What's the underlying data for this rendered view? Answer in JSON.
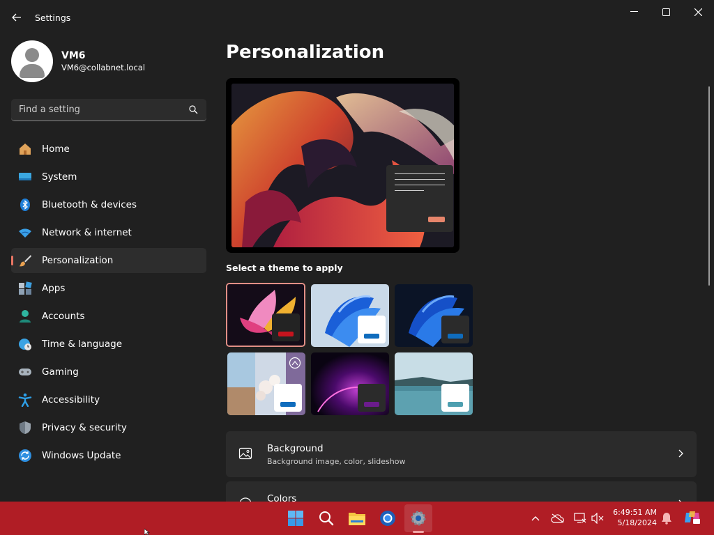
{
  "window": {
    "title": "Settings"
  },
  "profile": {
    "name": "VM6",
    "email": "VM6@collabnet.local"
  },
  "search": {
    "placeholder": "Find a setting"
  },
  "sidebar": {
    "items": [
      {
        "label": "Home",
        "icon": "home-icon"
      },
      {
        "label": "System",
        "icon": "system-icon"
      },
      {
        "label": "Bluetooth & devices",
        "icon": "bluetooth-icon"
      },
      {
        "label": "Network & internet",
        "icon": "wifi-icon"
      },
      {
        "label": "Personalization",
        "icon": "brush-icon",
        "active": true
      },
      {
        "label": "Apps",
        "icon": "apps-icon"
      },
      {
        "label": "Accounts",
        "icon": "accounts-icon"
      },
      {
        "label": "Time & language",
        "icon": "clock-globe-icon"
      },
      {
        "label": "Gaming",
        "icon": "gamepad-icon"
      },
      {
        "label": "Accessibility",
        "icon": "accessibility-icon"
      },
      {
        "label": "Privacy & security",
        "icon": "shield-icon"
      },
      {
        "label": "Windows Update",
        "icon": "update-icon"
      }
    ]
  },
  "main": {
    "title": "Personalization",
    "theme_heading": "Select a theme to apply",
    "themes": [
      {
        "name": "theme-glow",
        "accent": "#c6141e",
        "selected": true
      },
      {
        "name": "theme-windows-light",
        "accent": "#0f6cbd",
        "selected": false
      },
      {
        "name": "theme-windows-dark",
        "accent": "#0f6cbd",
        "selected": false
      },
      {
        "name": "theme-spotlight",
        "accent": "#0f6cbd",
        "selected": false
      },
      {
        "name": "theme-captured-motion",
        "accent": "#6b1c8c",
        "selected": false
      },
      {
        "name": "theme-flow",
        "accent": "#4d9fb0",
        "selected": false
      }
    ],
    "cards": [
      {
        "title": "Background",
        "subtitle": "Background image, color, slideshow"
      },
      {
        "title": "Colors",
        "subtitle": ""
      }
    ]
  },
  "taskbar": {
    "apps": [
      "start-icon",
      "search-icon",
      "file-explorer-icon",
      "chrome-icon",
      "settings-icon"
    ],
    "clock": {
      "time": "6:49:51 AM",
      "date": "5/18/2024"
    }
  },
  "colors": {
    "accent": "#e87563",
    "taskbar": "#b01d25",
    "background": "#202020"
  }
}
